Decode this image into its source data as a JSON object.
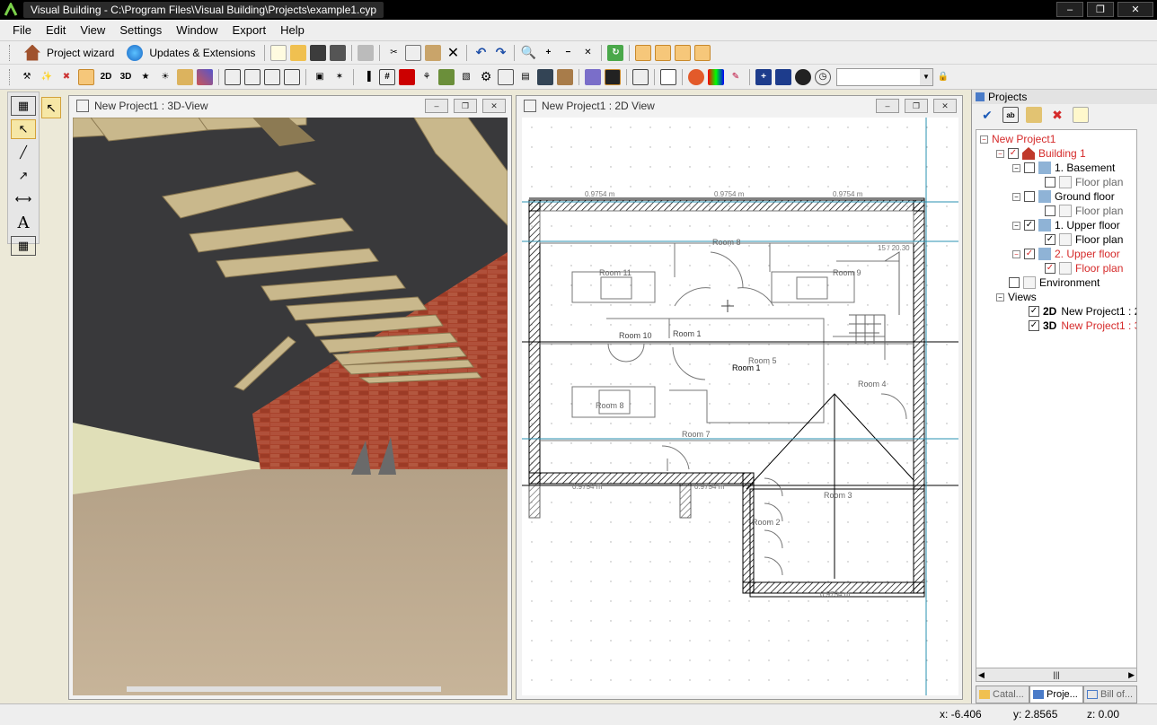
{
  "window": {
    "title": "Visual Building - C:\\Program Files\\Visual Building\\Projects\\example1.cyp"
  },
  "menu": [
    "File",
    "Edit",
    "View",
    "Settings",
    "Window",
    "Export",
    "Help"
  ],
  "toolbar1": {
    "wizard_label": "Project wizard",
    "updates_label": "Updates & Extensions"
  },
  "view3d": {
    "title": "New Project1 : 3D-View"
  },
  "view2d": {
    "title": "New Project1 : 2D View",
    "dims": [
      "0.9754 m",
      "0.9754 m",
      "0.9754 m",
      "0.9754 m",
      "0.9754 m",
      "0.9754 m"
    ],
    "rooms": [
      "Room 8",
      "Room 11",
      "Room 9",
      "Room 10",
      "Room 1",
      "Room 1",
      "Room 5",
      "Room 4",
      "Room 8",
      "Room 7",
      "Room 3",
      "Room 2"
    ],
    "stair_label": "15 / 20.30"
  },
  "projects": {
    "title": "Projects",
    "tree": {
      "project": "New Project1",
      "building": "Building 1",
      "basement": "1. Basement",
      "floor_plan": "Floor plan",
      "ground": "Ground floor",
      "upper1": "1. Upper floor",
      "upper2": "2. Upper floor",
      "environment": "Environment",
      "views": "Views",
      "view2d_tag": "2D",
      "view2d_name": "New Project1 : 2",
      "view3d_tag": "3D",
      "view3d_name": "New Project1 : 3"
    },
    "tabs": [
      "Catal...",
      "Proje...",
      "Bill of..."
    ]
  },
  "status": {
    "x": "x: -6.406",
    "y": "y: 2.8565",
    "z": "z: 0.00"
  }
}
